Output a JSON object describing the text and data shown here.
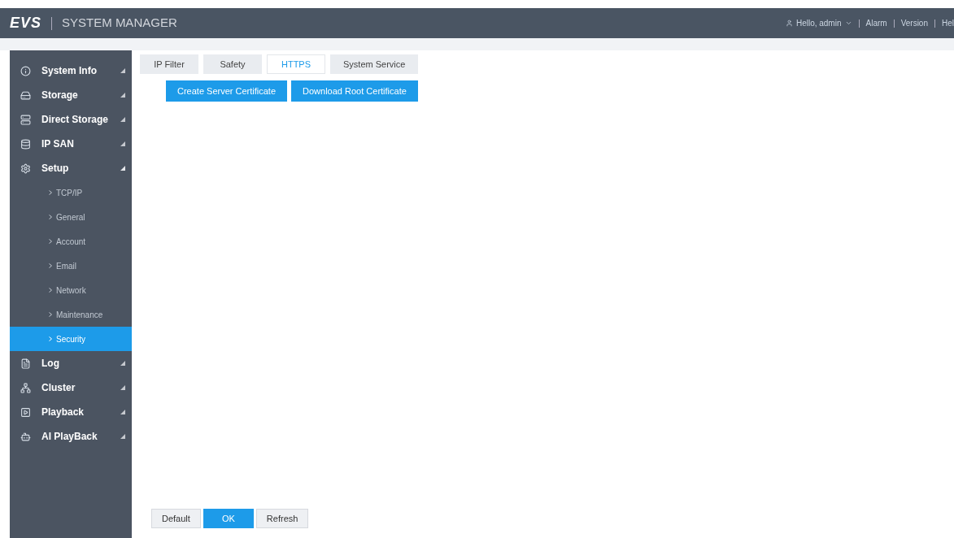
{
  "header": {
    "logo": "EVS",
    "title": "SYSTEM MANAGER",
    "links": [
      {
        "label": "Hello, admin",
        "kind": "user"
      },
      {
        "label": "Alarm",
        "kind": "link"
      },
      {
        "label": "Version",
        "kind": "link"
      },
      {
        "label": "Hel",
        "kind": "link"
      }
    ]
  },
  "sidebar": {
    "items": [
      {
        "label": "System Info",
        "expanded": false
      },
      {
        "label": "Storage",
        "expanded": false
      },
      {
        "label": "Direct Storage",
        "expanded": false
      },
      {
        "label": "IP SAN",
        "expanded": false
      },
      {
        "label": "Setup",
        "expanded": true,
        "children": [
          {
            "label": "TCP/IP",
            "selected": false
          },
          {
            "label": "General",
            "selected": false
          },
          {
            "label": "Account",
            "selected": false
          },
          {
            "label": "Email",
            "selected": false
          },
          {
            "label": "Network",
            "selected": false
          },
          {
            "label": "Maintenance",
            "selected": false
          },
          {
            "label": "Security",
            "selected": true
          }
        ]
      },
      {
        "label": "Log",
        "expanded": false
      },
      {
        "label": "Cluster",
        "expanded": false
      },
      {
        "label": "Playback",
        "expanded": false
      },
      {
        "label": "AI PlayBack",
        "expanded": false
      }
    ]
  },
  "tabs": [
    {
      "label": "IP Filter",
      "selected": false
    },
    {
      "label": "Safety",
      "selected": false
    },
    {
      "label": "HTTPS",
      "selected": true
    },
    {
      "label": "System Service",
      "selected": false
    }
  ],
  "actions": [
    "Create Server Certificate",
    "Download Root Certificate"
  ],
  "footer_buttons": [
    {
      "label": "Default",
      "primary": false
    },
    {
      "label": "OK",
      "primary": true
    },
    {
      "label": "Refresh",
      "primary": false
    }
  ]
}
